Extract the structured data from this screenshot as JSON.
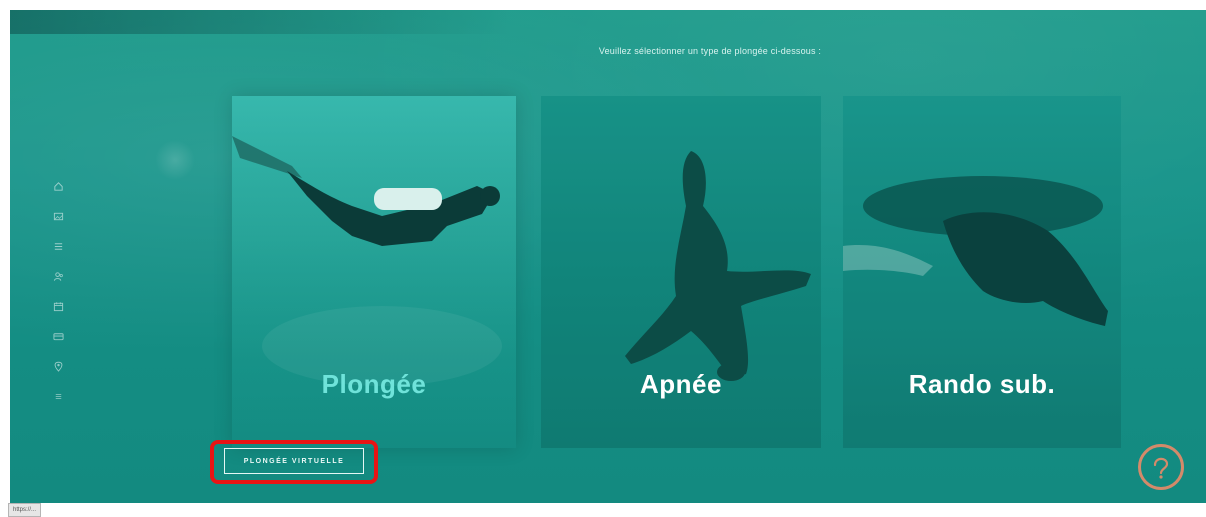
{
  "instruction": "Veuillez sélectionner un type de plongée ci-dessous :",
  "cards": [
    {
      "label": "Plongée",
      "selected": true
    },
    {
      "label": "Apnée",
      "selected": false
    },
    {
      "label": "Rando sub.",
      "selected": false
    }
  ],
  "virtual_button": {
    "label": "PLONGÉE VIRTUELLE"
  },
  "sidebar": {
    "icons": [
      "home-icon",
      "image-icon",
      "list-icon",
      "users-icon",
      "calendar-icon",
      "card-icon",
      "location-pin-icon",
      "menu-icon"
    ]
  },
  "help_button": {
    "icon": "question-icon"
  },
  "status_bar": {
    "url": "https://..."
  },
  "colors": {
    "background": "#17948a",
    "active_label": "#6fe3da",
    "highlight": "#e81414",
    "help_ring": "#d48a6a"
  }
}
